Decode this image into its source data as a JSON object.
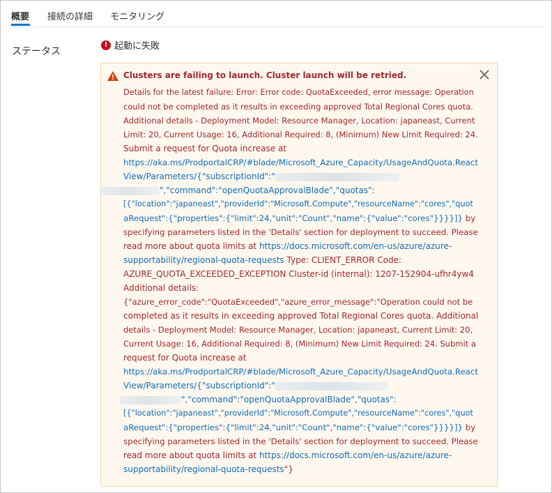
{
  "tabs": [
    {
      "label": "概要",
      "active": true
    },
    {
      "label": "接続の詳細",
      "active": false
    },
    {
      "label": "モニタリング",
      "active": false
    }
  ],
  "status": {
    "label": "ステータス",
    "value": "起動に失敗",
    "icon": "error-circle-icon",
    "icon_color": "#c50f1f"
  },
  "alert": {
    "title": "Clusters are failing to launch. Cluster launch will be retried.",
    "icon": "warning-triangle-icon",
    "close_icon": "close-icon",
    "colors": {
      "text": "#a4262c",
      "link": "#0f6cbd",
      "background": "#fff8ef",
      "border": "#f0d7a7"
    },
    "lines": [
      [
        "Details for the latest failure: Error: Error code: QuotaExceeded, error message: Operation"
      ],
      [
        "could not be completed as it results in exceeding approved Total Regional Cores quota."
      ],
      [
        "Additional details - Deployment Model: Resource Manager, Location: japaneast, Current"
      ],
      [
        "Limit: 20, Current Usage: 16, Additional Required: 8, (Minimum) New Limit Required: 24."
      ],
      [
        "Submit a request for Quota increase at"
      ],
      [
        "https://aka.ms/ProdportalCRP/#blade/Microsoft_Azure_Capacity/UsageAndQuota.React"
      ],
      [
        "View/Parameters/{\"subscriptionId\":\""
      ],
      [
        "\",\"command\":\"openQuotaApprovalBlade\",\"quotas\":"
      ],
      [
        "[{\"location\":\"japaneast\",\"providerId\":\"Microsoft.Compute\",\"resourceName\":\"cores\",\"quot"
      ],
      [
        "aRequest\":{\"properties\":{\"limit\":24,\"unit\":\"Count\",\"name\":{\"value\":\"cores\"}}}}]}",
        " by"
      ],
      [
        "specifying parameters listed in the 'Details' section for deployment to succeed. Please"
      ],
      [
        "read more about quota limits at ",
        "https://docs.microsoft.com/en-us/azure/azure-"
      ],
      [
        "supportability/regional-quota-requests",
        " Type: CLIENT_ERROR Code:"
      ],
      [
        "AZURE_QUOTA_EXCEEDED_EXCEPTION Cluster-id (internal): 1207-152904-ufhr4yw4"
      ],
      [
        "Additional details:"
      ],
      [
        "{\"azure_error_code\":\"QuotaExceeded\",\"azure_error_message\":\"Operation could not be"
      ],
      [
        "completed as it results in exceeding approved Total Regional Cores quota. Additional"
      ],
      [
        "details - Deployment Model: Resource Manager, Location: japaneast, Current Limit: 20,"
      ],
      [
        "Current Usage: 16, Additional Required: 8, (Minimum) New Limit Required: 24. Submit a"
      ],
      [
        "request for Quota increase at"
      ],
      [
        "https://aka.ms/ProdportalCRP/#blade/Microsoft_Azure_Capacity/UsageAndQuota.React"
      ],
      [
        "View/Parameters/{\"subscriptionId\":\""
      ],
      [
        "\",\"command\":\"openQuotaApprovalBlade\",\"quotas\":"
      ],
      [
        "[{\"location\":\"japaneast\",\"providerId\":\"Microsoft.Compute\",\"resourceName\":\"cores\",\"quot"
      ],
      [
        "aRequest\":{\"properties\":{\"limit\":24,\"unit\":\"Count\",\"name\":{\"value\":\"cores\"}}}}]}",
        " by"
      ],
      [
        "specifying parameters listed in the 'Details' section for deployment to succeed. Please"
      ],
      [
        "read more about quota limits at ",
        "https://docs.microsoft.com/en-us/azure/azure-"
      ],
      [
        "supportability/regional-quota-requests",
        "\"}"
      ]
    ]
  }
}
